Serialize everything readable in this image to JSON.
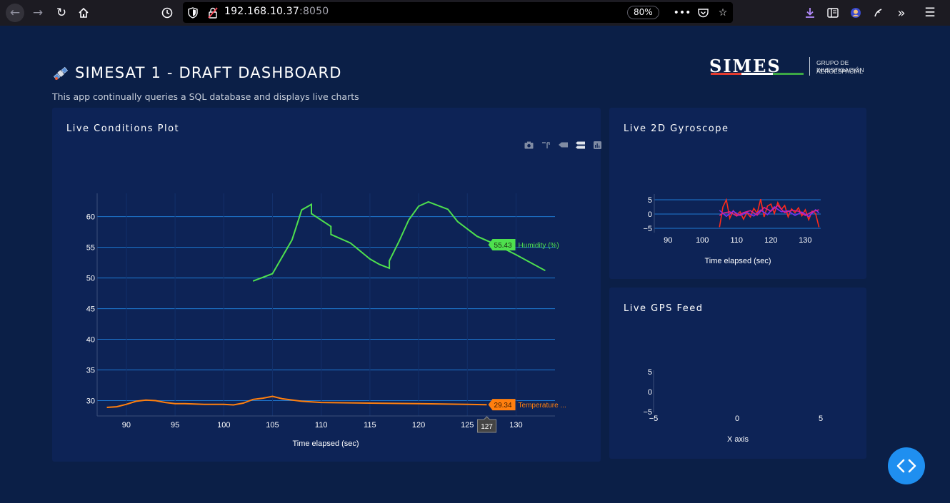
{
  "browser": {
    "url_host": "192.168.10.37",
    "url_port": ":8050",
    "zoom": "80%"
  },
  "header": {
    "title": "SIMESAT 1 - DRAFT DASHBOARD",
    "subtitle": "This app continually queries a SQL database and displays live charts",
    "logo_text": "SIMES",
    "logo_sub_line1": "GRUPO DE INVESTIGACIÓN",
    "logo_sub_line2": "AEROESPACIAL"
  },
  "panels": {
    "conditions_title": "Live Conditions Plot",
    "gyro_title": "Live 2D Gyroscope",
    "gps_title": "Live GPS Feed"
  },
  "colors": {
    "humidity": "#4ee04e",
    "temperature": "#ff7f0e",
    "gyro_red": "#ff2a1a",
    "gyro_purple": "#7a2ff0",
    "gyro_magenta": "#e0208a",
    "grid": "#1f78d1",
    "fab": "#1f8ff0"
  },
  "chart_data": [
    {
      "type": "line",
      "xlabel": "Time elapsed (sec)",
      "xlim": [
        87,
        134
      ],
      "ylim": [
        27.5,
        63.8
      ],
      "x_ticks": [
        90,
        95,
        100,
        105,
        110,
        115,
        120,
        125,
        130
      ],
      "y_ticks": [
        30,
        35,
        40,
        45,
        50,
        55,
        60
      ],
      "hover": {
        "x_label": "127",
        "humidity_value": "55.43",
        "humidity_name": "Humidity (%)",
        "temperature_value": "29.34",
        "temperature_name": "Temperature ..."
      },
      "series": [
        {
          "name": "Humidity (%)",
          "x": [
            103,
            105,
            107,
            108,
            109,
            109,
            111,
            111,
            113,
            115,
            116,
            117,
            117,
            118,
            119,
            120,
            121,
            123,
            124,
            126,
            128,
            130,
            133
          ],
          "y": [
            49.5,
            50.7,
            56.2,
            61.1,
            62.0,
            60.5,
            58.4,
            57.1,
            55.7,
            53.1,
            52.2,
            51.6,
            52.8,
            56.0,
            59.5,
            61.7,
            62.4,
            61.2,
            59.2,
            56.8,
            55.4,
            53.8,
            51.2
          ]
        },
        {
          "name": "Temperature ...",
          "x": [
            88,
            89,
            90,
            91,
            92,
            93,
            94,
            95,
            96,
            98,
            100,
            101,
            102,
            103,
            104,
            105,
            106,
            108,
            110,
            115,
            120,
            125,
            127
          ],
          "y": [
            28.9,
            29.0,
            29.4,
            29.9,
            30.1,
            30.0,
            29.7,
            29.5,
            29.5,
            29.4,
            29.4,
            29.3,
            29.6,
            30.2,
            30.4,
            30.7,
            30.3,
            29.9,
            29.7,
            29.6,
            29.5,
            29.4,
            29.34
          ]
        }
      ]
    },
    {
      "type": "line",
      "xlabel": "Time elapsed (sec)",
      "xlim": [
        86,
        134.5
      ],
      "ylim": [
        -6.5,
        7
      ],
      "x_ticks": [
        90,
        100,
        110,
        120,
        130
      ],
      "y_ticks": [
        -5,
        0,
        5
      ],
      "series": [
        {
          "x": [
            105,
            106,
            107,
            108,
            109,
            110,
            111,
            112,
            113,
            114,
            115,
            116,
            117,
            118,
            119,
            120,
            121,
            122,
            123,
            124,
            125,
            126,
            127,
            128,
            129,
            130,
            131,
            132,
            133,
            134
          ],
          "y": [
            -4.6,
            2.5,
            5.0,
            -1.5,
            1.2,
            -0.3,
            0.8,
            -1.8,
            0.5,
            -1.0,
            2.0,
            0.3,
            5.2,
            -1.0,
            2.8,
            3.5,
            0.2,
            4.0,
            1.6,
            3.0,
            -1.0,
            1.8,
            0.5,
            2.2,
            -0.6,
            1.5,
            -2.0,
            1.0,
            0.2,
            -4.6
          ]
        },
        {
          "x": [
            105,
            107,
            109,
            111,
            113,
            115,
            117,
            119,
            121,
            123,
            125,
            127,
            129,
            131,
            133,
            134
          ],
          "y": [
            1.3,
            -0.8,
            1.0,
            -0.5,
            0.6,
            -0.7,
            1.4,
            -0.2,
            2.5,
            0.8,
            1.1,
            -0.5,
            0.7,
            -0.9,
            1.5,
            0.4
          ]
        },
        {
          "x": [
            105,
            106,
            108,
            110,
            112,
            114,
            116,
            118,
            120,
            122,
            124,
            126,
            128,
            130,
            132,
            134
          ],
          "y": [
            -0.5,
            0.3,
            0.8,
            -0.7,
            0.5,
            1.2,
            -0.4,
            2.3,
            1.0,
            3.0,
            0.5,
            1.3,
            1.0,
            -0.5,
            0.8,
            1.5
          ]
        }
      ]
    },
    {
      "type": "scatter",
      "xlabel": "X axis",
      "xlim": [
        -5,
        5
      ],
      "ylim": [
        -5,
        5
      ],
      "x_ticks": [
        -5,
        0,
        5
      ],
      "y_ticks": [
        -5,
        0,
        5
      ],
      "series": []
    }
  ]
}
